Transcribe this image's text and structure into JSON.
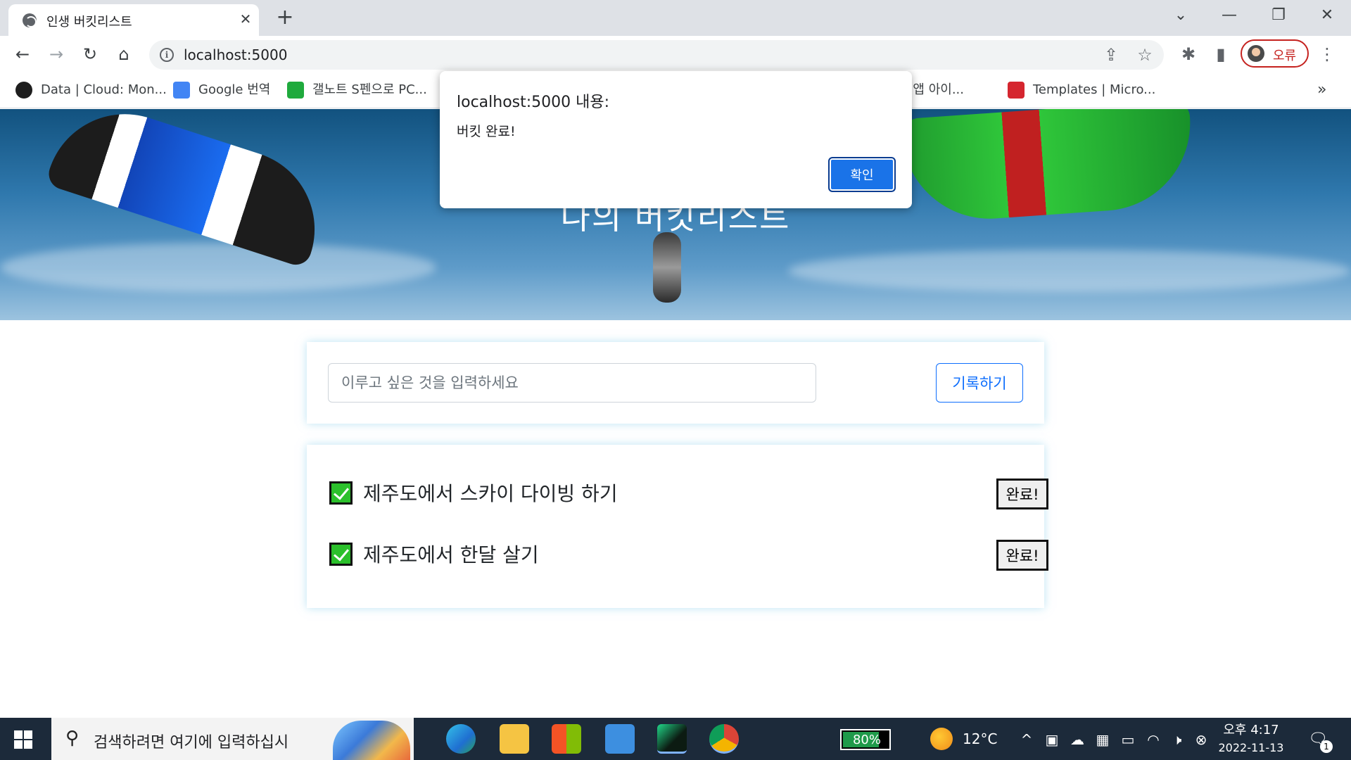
{
  "browser": {
    "tab_title": "인생 버킷리스트",
    "tab_close": "✕",
    "new_tab": "+",
    "window_controls": {
      "dropdown": "⌄",
      "minimize": "—",
      "restore": "❐",
      "close": "✕"
    },
    "url": "localhost:5000",
    "profile_label": "오류",
    "nav_icons": {
      "back": "←",
      "forward": "→",
      "reload": "↻",
      "home": "⌂",
      "share": "⇪",
      "star": "☆",
      "extensions": "✱",
      "sidepanel": "▮",
      "menu": "⋮"
    },
    "bookmarks": [
      {
        "label": "Data | Cloud: Mon...",
        "icon": "mongodb-leaf-icon",
        "color": "#13aa52"
      },
      {
        "label": "Google 번역",
        "icon": "google-translate-icon",
        "color": "#4285f4"
      },
      {
        "label": "갤노트 S펜으로 PC...",
        "icon": "green-note-icon",
        "color": "#1faa3d"
      },
      {
        "label": "n 및 앱 아이...",
        "icon": "",
        "color": ""
      },
      {
        "label": "Templates | Micro...",
        "icon": "templates-w-icon",
        "color": "#d5262f"
      }
    ],
    "bookmarks_more": "»"
  },
  "page": {
    "hero_title": "나의 버킷리스트",
    "input_placeholder": "이루고 싶은 것을 입력하세요",
    "record_button": "기록하기",
    "buckets": [
      {
        "text": "제주도에서 스카이 다이빙 하기",
        "done_label": "완료!",
        "checked": true
      },
      {
        "text": "제주도에서 한달 살기",
        "done_label": "완료!",
        "checked": true
      }
    ],
    "colors": {
      "check": "#2bc02b",
      "record_button": "#0d6efd"
    }
  },
  "dialog": {
    "title": "localhost:5000 내용:",
    "message": "버킷 완료!",
    "ok_label": "확인",
    "ok_color": "#1a73e8"
  },
  "taskbar": {
    "search_placeholder": "검색하려면 여기에 입력하십시",
    "search_icon": "⚲",
    "apps": [
      "edge-icon",
      "file-explorer-icon",
      "microsoft-store-icon",
      "app-window-icon",
      "pycharm-icon",
      "chrome-icon"
    ],
    "battery_percent": "80%",
    "battery_level": 0.8,
    "weather": "12°C",
    "tray_icons": {
      "chevron": "^",
      "meet": "▣",
      "onedrive": "☁",
      "display": "▦",
      "power": "▭",
      "wifi": "◠",
      "volume": "🕨",
      "close": "⊗"
    },
    "time": "오후 4:17",
    "date": "2022-11-13",
    "notification_icon": "🗨",
    "notification_count": "1"
  }
}
